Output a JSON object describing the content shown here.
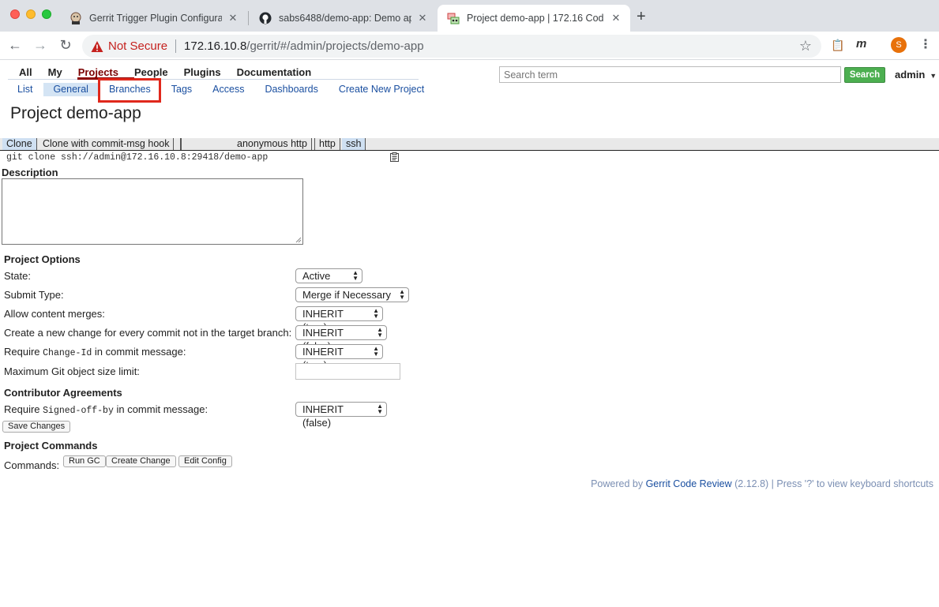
{
  "browser": {
    "tabs": [
      {
        "title": "Gerrit Trigger Plugin Configura",
        "favicon": "jenkins-icon",
        "active": false
      },
      {
        "title": "sabs6488/demo-app: Demo ap",
        "favicon": "github-icon",
        "active": false
      },
      {
        "title": "Project demo-app | 172.16 Cod",
        "favicon": "gerrit-icon",
        "active": true
      }
    ],
    "security_label": "Not Secure",
    "url_host": "172.16.10.8",
    "url_path": "/gerrit/#/admin/projects/demo-app",
    "profile_initial": "S"
  },
  "gerrit": {
    "top_menu": [
      "All",
      "My",
      "Projects",
      "People",
      "Plugins",
      "Documentation"
    ],
    "active_top": "Projects",
    "sub_menu": [
      "List",
      "General",
      "Branches",
      "Tags",
      "Access",
      "Dashboards",
      "Create New Project"
    ],
    "active_sub": "General",
    "search_placeholder": "Search term",
    "search_button": "Search",
    "user": "admin",
    "page_title": "Project demo-app",
    "clone": {
      "tab_clone": "Clone",
      "tab_clone_hook": "Clone with commit-msg hook",
      "proto_anonymous": "anonymous http",
      "proto_http": "http",
      "proto_ssh": "ssh",
      "command": "git clone ssh://admin@172.16.10.8:29418/demo-app"
    },
    "description_label": "Description",
    "description_value": "",
    "project_options_heading": "Project Options",
    "options": {
      "state_label": "State:",
      "state_value": "Active",
      "submit_label": "Submit Type:",
      "submit_value": "Merge if Necessary",
      "content_merges_label": "Allow content merges:",
      "content_merges_value": "INHERIT (true)",
      "new_change_label": "Create a new change for every commit not in the target branch:",
      "new_change_value": "INHERIT (false)",
      "require_prefix": "Require ",
      "change_id_code": "Change-Id",
      "require_suffix": " in commit message:",
      "change_id_value": "INHERIT (true)",
      "max_size_label": "Maximum Git object size limit:",
      "max_size_value": ""
    },
    "contributor_heading": "Contributor Agreements",
    "signed_off_code": "Signed-off-by",
    "signed_off_value": "INHERIT (false)",
    "save_button": "Save Changes",
    "commands_heading": "Project Commands",
    "commands_label": "Commands:",
    "command_buttons": [
      "Run GC",
      "Create Change",
      "Edit Config"
    ],
    "footer": {
      "powered_by": "Powered by ",
      "product": "Gerrit Code Review",
      "version_text": " (2.12.8) | Press '?' to view keyboard shortcuts"
    }
  }
}
